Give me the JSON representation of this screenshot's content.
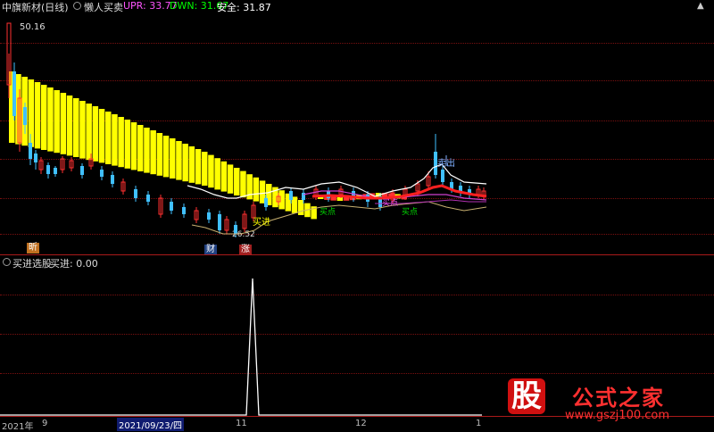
{
  "main_panel": {
    "title": "中旗新材(日线)",
    "indicator_name": "懒人买卖",
    "upr_label": "UPR: 33.77",
    "dwn_label": "DWN: 31.67",
    "safe_label": "安全: 31.87",
    "high_price_label": "50.16",
    "low_price_label": "26.52",
    "annotations": {
      "buy_in": "买进",
      "sell_out": "卖出",
      "buy_point_1": "买点",
      "buy_point_2": "买点",
      "buy_point_3": "买点"
    },
    "markers": {
      "marker_left": "昕",
      "marker_cai": "财",
      "marker_zhang": "涨"
    }
  },
  "sub_panel": {
    "indicator_name": "买进选股",
    "value_label": "买进: 0.00"
  },
  "time_axis": {
    "labels": [
      "2021年",
      "9",
      "2021/09/23/四",
      "11",
      "12",
      "1"
    ]
  },
  "watermark": {
    "left_glyph": "股",
    "right_text": "公式之家",
    "url": "www.gszj100.com"
  },
  "colors": {
    "upr": "#ff55ff",
    "dwn": "#00ff00",
    "safe": "#ffffff",
    "yellow_band": "#ffff00",
    "up_candle": "#ff3030",
    "down_candle": "#40c0ff",
    "grid": "#7a1010",
    "mid_line": "#b030b0"
  }
}
